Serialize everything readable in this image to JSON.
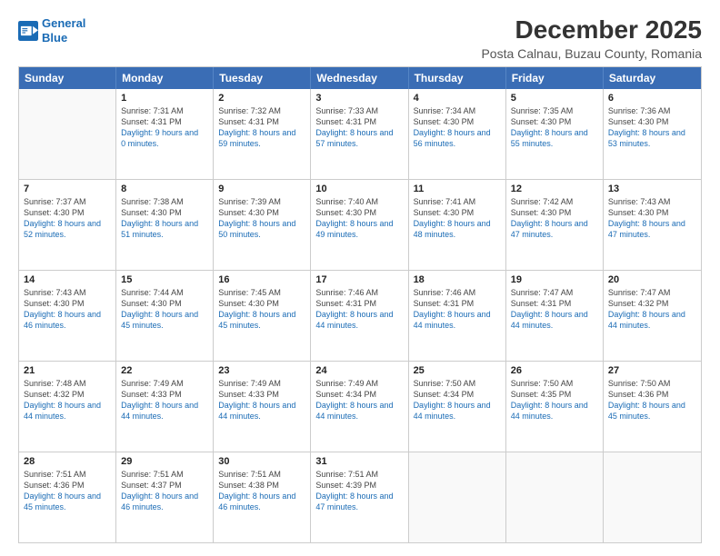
{
  "header": {
    "logo_line1": "General",
    "logo_line2": "Blue",
    "title": "December 2025",
    "subtitle": "Posta Calnau, Buzau County, Romania"
  },
  "calendar": {
    "weekdays": [
      "Sunday",
      "Monday",
      "Tuesday",
      "Wednesday",
      "Thursday",
      "Friday",
      "Saturday"
    ],
    "rows": [
      [
        {
          "day": "",
          "sunrise": "",
          "sunset": "",
          "daylight": ""
        },
        {
          "day": "1",
          "sunrise": "Sunrise: 7:31 AM",
          "sunset": "Sunset: 4:31 PM",
          "daylight": "Daylight: 9 hours and 0 minutes."
        },
        {
          "day": "2",
          "sunrise": "Sunrise: 7:32 AM",
          "sunset": "Sunset: 4:31 PM",
          "daylight": "Daylight: 8 hours and 59 minutes."
        },
        {
          "day": "3",
          "sunrise": "Sunrise: 7:33 AM",
          "sunset": "Sunset: 4:31 PM",
          "daylight": "Daylight: 8 hours and 57 minutes."
        },
        {
          "day": "4",
          "sunrise": "Sunrise: 7:34 AM",
          "sunset": "Sunset: 4:30 PM",
          "daylight": "Daylight: 8 hours and 56 minutes."
        },
        {
          "day": "5",
          "sunrise": "Sunrise: 7:35 AM",
          "sunset": "Sunset: 4:30 PM",
          "daylight": "Daylight: 8 hours and 55 minutes."
        },
        {
          "day": "6",
          "sunrise": "Sunrise: 7:36 AM",
          "sunset": "Sunset: 4:30 PM",
          "daylight": "Daylight: 8 hours and 53 minutes."
        }
      ],
      [
        {
          "day": "7",
          "sunrise": "Sunrise: 7:37 AM",
          "sunset": "Sunset: 4:30 PM",
          "daylight": "Daylight: 8 hours and 52 minutes."
        },
        {
          "day": "8",
          "sunrise": "Sunrise: 7:38 AM",
          "sunset": "Sunset: 4:30 PM",
          "daylight": "Daylight: 8 hours and 51 minutes."
        },
        {
          "day": "9",
          "sunrise": "Sunrise: 7:39 AM",
          "sunset": "Sunset: 4:30 PM",
          "daylight": "Daylight: 8 hours and 50 minutes."
        },
        {
          "day": "10",
          "sunrise": "Sunrise: 7:40 AM",
          "sunset": "Sunset: 4:30 PM",
          "daylight": "Daylight: 8 hours and 49 minutes."
        },
        {
          "day": "11",
          "sunrise": "Sunrise: 7:41 AM",
          "sunset": "Sunset: 4:30 PM",
          "daylight": "Daylight: 8 hours and 48 minutes."
        },
        {
          "day": "12",
          "sunrise": "Sunrise: 7:42 AM",
          "sunset": "Sunset: 4:30 PM",
          "daylight": "Daylight: 8 hours and 47 minutes."
        },
        {
          "day": "13",
          "sunrise": "Sunrise: 7:43 AM",
          "sunset": "Sunset: 4:30 PM",
          "daylight": "Daylight: 8 hours and 47 minutes."
        }
      ],
      [
        {
          "day": "14",
          "sunrise": "Sunrise: 7:43 AM",
          "sunset": "Sunset: 4:30 PM",
          "daylight": "Daylight: 8 hours and 46 minutes."
        },
        {
          "day": "15",
          "sunrise": "Sunrise: 7:44 AM",
          "sunset": "Sunset: 4:30 PM",
          "daylight": "Daylight: 8 hours and 45 minutes."
        },
        {
          "day": "16",
          "sunrise": "Sunrise: 7:45 AM",
          "sunset": "Sunset: 4:30 PM",
          "daylight": "Daylight: 8 hours and 45 minutes."
        },
        {
          "day": "17",
          "sunrise": "Sunrise: 7:46 AM",
          "sunset": "Sunset: 4:31 PM",
          "daylight": "Daylight: 8 hours and 44 minutes."
        },
        {
          "day": "18",
          "sunrise": "Sunrise: 7:46 AM",
          "sunset": "Sunset: 4:31 PM",
          "daylight": "Daylight: 8 hours and 44 minutes."
        },
        {
          "day": "19",
          "sunrise": "Sunrise: 7:47 AM",
          "sunset": "Sunset: 4:31 PM",
          "daylight": "Daylight: 8 hours and 44 minutes."
        },
        {
          "day": "20",
          "sunrise": "Sunrise: 7:47 AM",
          "sunset": "Sunset: 4:32 PM",
          "daylight": "Daylight: 8 hours and 44 minutes."
        }
      ],
      [
        {
          "day": "21",
          "sunrise": "Sunrise: 7:48 AM",
          "sunset": "Sunset: 4:32 PM",
          "daylight": "Daylight: 8 hours and 44 minutes."
        },
        {
          "day": "22",
          "sunrise": "Sunrise: 7:49 AM",
          "sunset": "Sunset: 4:33 PM",
          "daylight": "Daylight: 8 hours and 44 minutes."
        },
        {
          "day": "23",
          "sunrise": "Sunrise: 7:49 AM",
          "sunset": "Sunset: 4:33 PM",
          "daylight": "Daylight: 8 hours and 44 minutes."
        },
        {
          "day": "24",
          "sunrise": "Sunrise: 7:49 AM",
          "sunset": "Sunset: 4:34 PM",
          "daylight": "Daylight: 8 hours and 44 minutes."
        },
        {
          "day": "25",
          "sunrise": "Sunrise: 7:50 AM",
          "sunset": "Sunset: 4:34 PM",
          "daylight": "Daylight: 8 hours and 44 minutes."
        },
        {
          "day": "26",
          "sunrise": "Sunrise: 7:50 AM",
          "sunset": "Sunset: 4:35 PM",
          "daylight": "Daylight: 8 hours and 44 minutes."
        },
        {
          "day": "27",
          "sunrise": "Sunrise: 7:50 AM",
          "sunset": "Sunset: 4:36 PM",
          "daylight": "Daylight: 8 hours and 45 minutes."
        }
      ],
      [
        {
          "day": "28",
          "sunrise": "Sunrise: 7:51 AM",
          "sunset": "Sunset: 4:36 PM",
          "daylight": "Daylight: 8 hours and 45 minutes."
        },
        {
          "day": "29",
          "sunrise": "Sunrise: 7:51 AM",
          "sunset": "Sunset: 4:37 PM",
          "daylight": "Daylight: 8 hours and 46 minutes."
        },
        {
          "day": "30",
          "sunrise": "Sunrise: 7:51 AM",
          "sunset": "Sunset: 4:38 PM",
          "daylight": "Daylight: 8 hours and 46 minutes."
        },
        {
          "day": "31",
          "sunrise": "Sunrise: 7:51 AM",
          "sunset": "Sunset: 4:39 PM",
          "daylight": "Daylight: 8 hours and 47 minutes."
        },
        {
          "day": "",
          "sunrise": "",
          "sunset": "",
          "daylight": ""
        },
        {
          "day": "",
          "sunrise": "",
          "sunset": "",
          "daylight": ""
        },
        {
          "day": "",
          "sunrise": "",
          "sunset": "",
          "daylight": ""
        }
      ]
    ]
  }
}
